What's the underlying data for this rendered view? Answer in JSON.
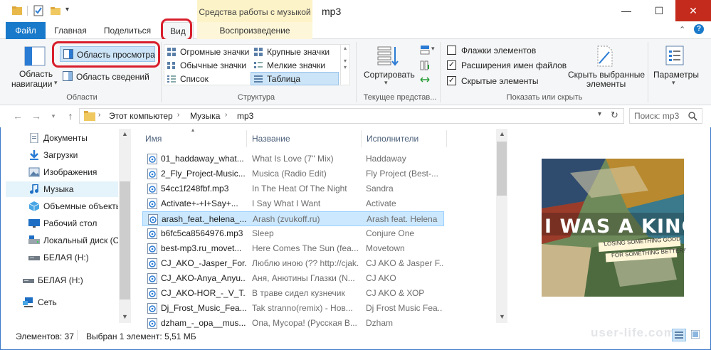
{
  "titlebar": {
    "context_tab": "Средства работы с музыкой",
    "title": "mp3",
    "minimize": "—",
    "maximize": "☐",
    "close": "✕"
  },
  "tabs": {
    "file": "Файл",
    "home": "Главная",
    "share": "Поделиться",
    "view": "Вид",
    "playback": "Воспроизведение"
  },
  "ribbon": {
    "panes": {
      "nav_pane": "Область",
      "nav_pane2": "навигации",
      "preview_pane": "Область просмотра",
      "details_pane": "Область сведений",
      "group": "Области"
    },
    "layout": {
      "extra_large": "Огромные значки",
      "large": "Крупные значки",
      "medium": "Обычные значки",
      "small": "Мелкие значки",
      "list": "Список",
      "details": "Таблица",
      "group": "Структура"
    },
    "current_view": {
      "sort": "Сортировать",
      "group": "Текущее представ..."
    },
    "show_hide": {
      "item_checkboxes": "Флажки элементов",
      "item_checkboxes_checked": false,
      "file_extensions": "Расширения имен файлов",
      "file_extensions_checked": true,
      "hidden_items": "Скрытые элементы",
      "hidden_items_checked": true,
      "hide_selected": "Скрыть выбранные",
      "hide_selected2": "элементы",
      "group": "Показать или скрыть"
    },
    "options": "Параметры"
  },
  "address": {
    "crumbs": [
      "Этот компьютер",
      "Музыка",
      "mp3"
    ],
    "search_placeholder": "Поиск: mp3"
  },
  "nav": {
    "items": [
      {
        "label": "Документы",
        "icon": "documents-icon"
      },
      {
        "label": "Загрузки",
        "icon": "downloads-icon"
      },
      {
        "label": "Изображения",
        "icon": "pictures-icon"
      },
      {
        "label": "Музыка",
        "icon": "music-icon",
        "selected": true
      },
      {
        "label": "Объемные объекты",
        "icon": "3d-objects-icon"
      },
      {
        "label": "Рабочий стол",
        "icon": "desktop-icon"
      },
      {
        "label": "Локальный диск (C:)",
        "icon": "local-disk-icon"
      },
      {
        "label": "БЕЛАЯ (H:)",
        "icon": "drive-icon"
      },
      {
        "label": "БЕЛАЯ (H:)",
        "icon": "drive-icon"
      },
      {
        "label": "Сеть",
        "icon": "network-icon"
      }
    ]
  },
  "columns": {
    "name": "Имя",
    "title": "Название",
    "artists": "Исполнители"
  },
  "files": [
    {
      "name": "01_haddaway_what...",
      "title": "What Is Love (7'' Mix)",
      "artist": "Haddaway"
    },
    {
      "name": "2_Fly_Project-Music...",
      "title": "Musica (Radio Edit)",
      "artist": "Fly Project (Best-..."
    },
    {
      "name": "54cc1f248fbf.mp3",
      "title": "In The Heat Of The Night",
      "artist": "Sandra"
    },
    {
      "name": "Activate+-+I+Say+...",
      "title": "I Say What I Want",
      "artist": "Activate"
    },
    {
      "name": "arash_feat._helena_...",
      "title": "Arash (zvukoff.ru)",
      "artist": "Arash feat. Helena",
      "selected": true
    },
    {
      "name": "b6fc5ca8564976.mp3",
      "title": "Sleep",
      "artist": "Conjure One"
    },
    {
      "name": "best-mp3.ru_movet...",
      "title": "Here Comes The Sun (fea...",
      "artist": "Movetown"
    },
    {
      "name": "CJ_AKO_-Jasper_For...",
      "title": "Люблю иною (?? http://cjak...",
      "artist": "CJ AKO & Jasper F..."
    },
    {
      "name": "CJ_AKO-Anya_Anyu...",
      "title": "Аня, Анютины Глазки (N...",
      "artist": "CJ AKO"
    },
    {
      "name": "CJ_AKO-HOR_-_V_T...",
      "title": "В траве сидел кузнечик",
      "artist": "CJ AKO & ХОР"
    },
    {
      "name": "Dj_Frost_Music_Fea...",
      "title": "Tak stranno(remix) - Нов...",
      "artist": "Dj Frost Music Fea..."
    },
    {
      "name": "dzham_-_opa__mus...",
      "title": "Опа, Мусора! (Русская В...",
      "artist": "Dzham"
    }
  ],
  "preview": {
    "headline": "I WAS A KING",
    "line1": "'LOSING SOMETHING GOOD",
    "line2": "FOR SOMETHING BETTER!'"
  },
  "status": {
    "count": "Элементов: 37",
    "selection": "Выбран 1 элемент: 5,51 МБ"
  },
  "watermark": "user-life.com",
  "colors": {
    "file_tab": "#1979ca",
    "highlight_ring": "#d81e2c",
    "selection": "#cce8ff"
  }
}
